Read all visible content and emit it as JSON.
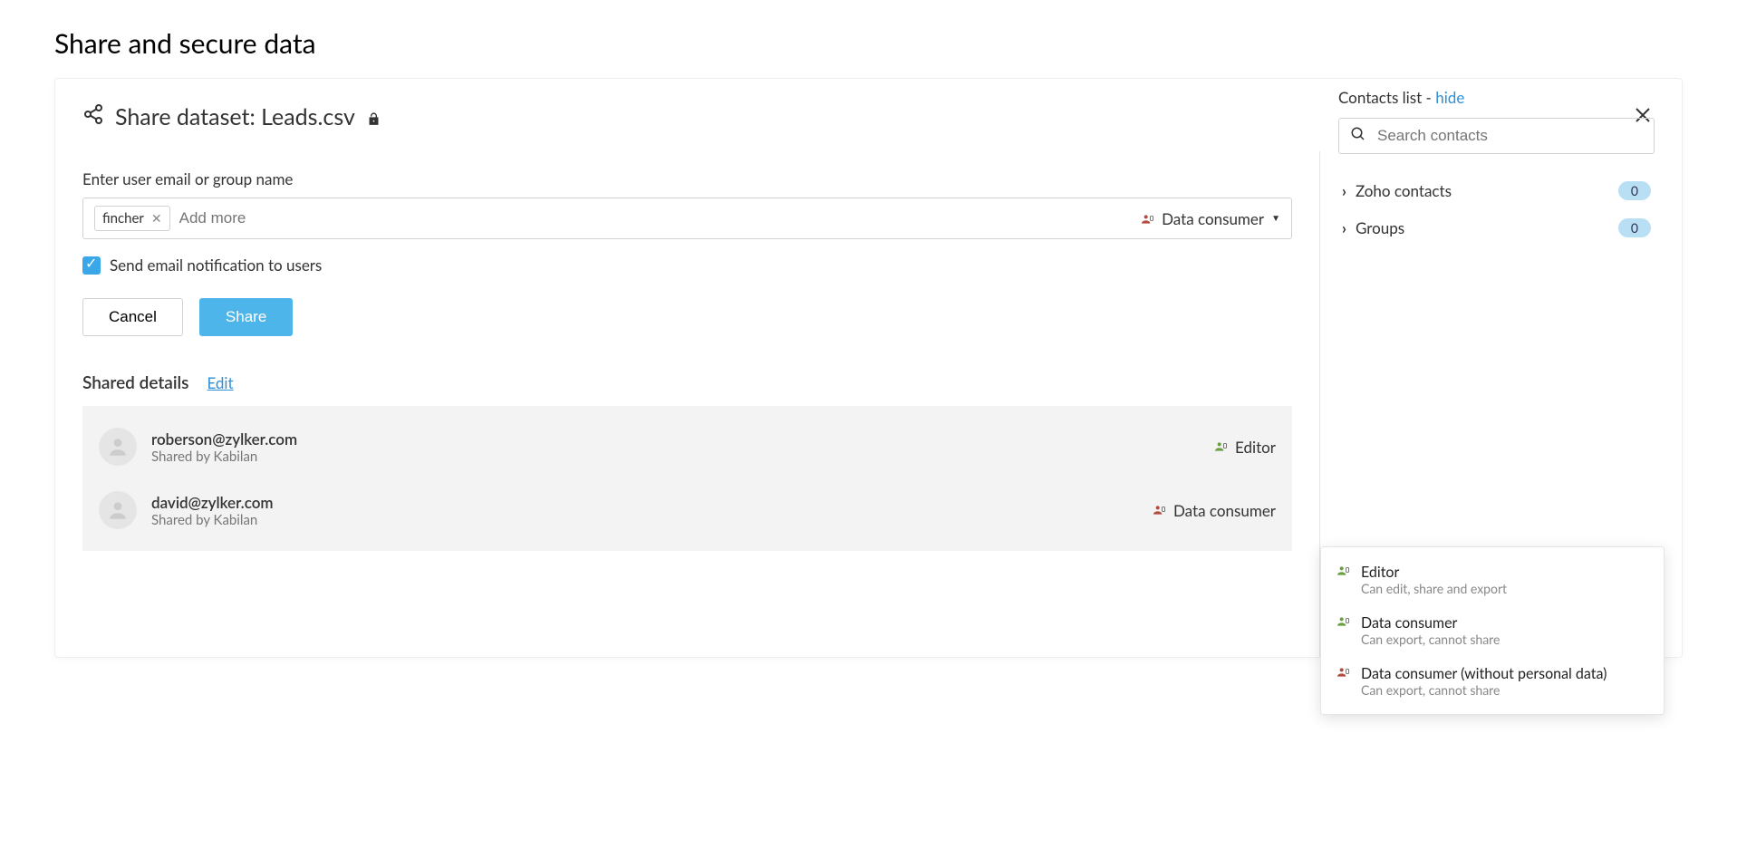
{
  "page": {
    "title": "Share and secure data"
  },
  "modal": {
    "title": "Share dataset: Leads.csv",
    "close": "×"
  },
  "left": {
    "input_label": "Enter user email or group name",
    "chip": "fincher",
    "add_more_placeholder": "Add more",
    "selected_role": "Data consumer",
    "notify_label": "Send email notification to users",
    "cancel": "Cancel",
    "share": "Share"
  },
  "shared": {
    "title": "Shared details",
    "edit": "Edit",
    "items": [
      {
        "email": "roberson@zylker.com",
        "by": "Shared by Kabilan",
        "role": "Editor",
        "role_color": "green"
      },
      {
        "email": "david@zylker.com",
        "by": "Shared by Kabilan",
        "role": "Data consumer",
        "role_color": "red"
      }
    ]
  },
  "contacts": {
    "header_prefix": "Contacts list - ",
    "hide": "hide",
    "search_placeholder": "Search contacts",
    "groups": [
      {
        "label": "Zoho contacts",
        "count": "0"
      },
      {
        "label": "Groups",
        "count": "0"
      }
    ]
  },
  "roles": [
    {
      "title": "Editor",
      "desc": "Can edit, share and export",
      "color": "green"
    },
    {
      "title": "Data consumer",
      "desc": "Can export, cannot share",
      "color": "green"
    },
    {
      "title": "Data consumer (without personal data)",
      "desc": "Can export, cannot share",
      "color": "red"
    }
  ]
}
